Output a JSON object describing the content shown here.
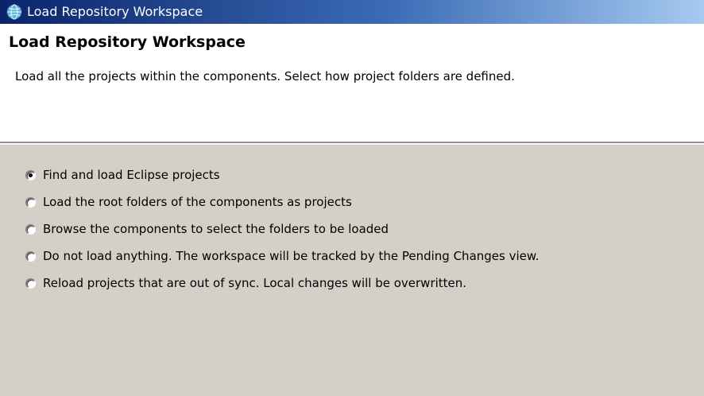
{
  "window": {
    "title": "Load Repository Workspace",
    "icon": "eclipse-globe-icon"
  },
  "header": {
    "title": "Load Repository Workspace",
    "description": "Load all the projects within the components. Select how project folders are defined."
  },
  "options": [
    {
      "label": "Find and load Eclipse projects",
      "selected": true
    },
    {
      "label": "Load the root folders of the components as projects",
      "selected": false
    },
    {
      "label": "Browse the components to select the folders to be loaded",
      "selected": false
    },
    {
      "label": "Do not load anything. The workspace will be tracked by the Pending Changes view.",
      "selected": false
    },
    {
      "label": "Reload projects that are out of sync. Local changes will be overwritten.",
      "selected": false
    }
  ],
  "colors": {
    "titlebar_start": "#0a246a",
    "titlebar_end": "#a6caf0",
    "dialog_bg": "#d4d0c8",
    "header_bg": "#ffffff"
  }
}
